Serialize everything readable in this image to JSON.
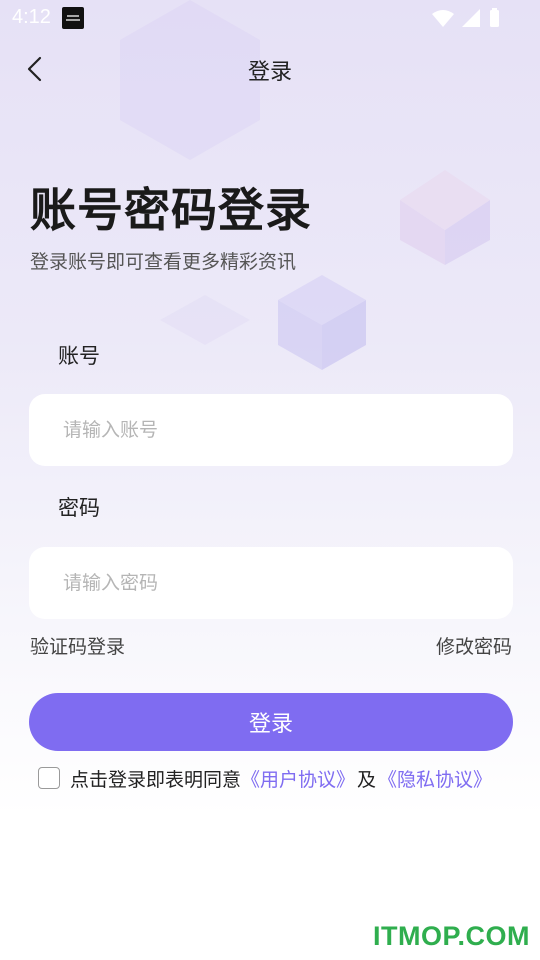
{
  "status_bar": {
    "time": "4:12",
    "icons": [
      "notification-icon",
      "wifi-icon",
      "signal-icon",
      "battery-icon"
    ]
  },
  "navbar": {
    "title": "登录",
    "back_icon": "chevron-left-icon"
  },
  "hero": {
    "title": "账号密码登录",
    "subtitle": "登录账号即可查看更多精彩资讯"
  },
  "form": {
    "account_label": "账号",
    "account_placeholder": "请输入账号",
    "account_value": "",
    "password_label": "密码",
    "password_placeholder": "请输入密码",
    "password_value": ""
  },
  "links": {
    "sms_login": "验证码登录",
    "change_password": "修改密码"
  },
  "login_button": "登录",
  "agreement": {
    "checked": false,
    "prefix": "点击登录即表明同意",
    "user_agreement": "《用户协议》",
    "conjunction": "及",
    "privacy_policy": "《隐私协议》"
  },
  "watermark": "ITMOP.COM",
  "colors": {
    "accent": "#7f6cf1",
    "watermark": "#2fae4e"
  }
}
